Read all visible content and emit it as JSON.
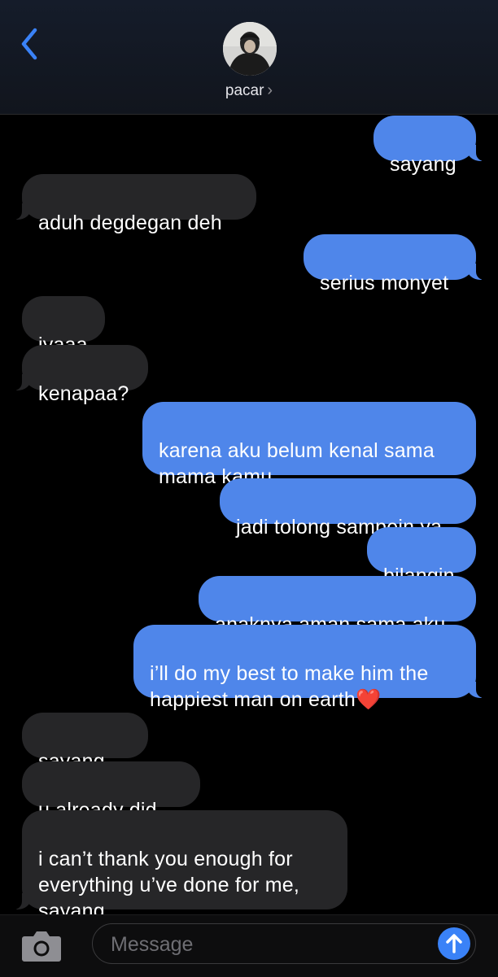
{
  "header": {
    "back_icon": "chevron-left-icon",
    "contact_name": "pacar",
    "contact_chevron": "›",
    "accent": "#3a82f7"
  },
  "messages": [
    {
      "direction": "sent",
      "text": "sayang"
    },
    {
      "direction": "received",
      "text": "aduh degdegan deh"
    },
    {
      "direction": "sent",
      "text": "serius monyet"
    },
    {
      "direction": "received",
      "text": "iyaaa"
    },
    {
      "direction": "received",
      "text": "kenapaa?"
    },
    {
      "direction": "sent",
      "text": "karena aku belum kenal sama\nmama kamu"
    },
    {
      "direction": "sent",
      "text": "jadi tolong sampein ya"
    },
    {
      "direction": "sent",
      "text": "bilangin"
    },
    {
      "direction": "sent",
      "text": "anaknya aman sama aku"
    },
    {
      "direction": "sent",
      "text": "i’ll do my best to make him the\nhappiest man on earth❤️"
    },
    {
      "direction": "received",
      "text": "sayang...."
    },
    {
      "direction": "received",
      "text": "u already did..."
    },
    {
      "direction": "received",
      "text": "i can’t thank you enough for\neverything u’ve done for me,\nsayang.."
    }
  ],
  "composer": {
    "placeholder": "Message",
    "camera_icon": "camera-icon",
    "send_icon": "send-arrow-up-icon"
  },
  "colors": {
    "sent_bubble": "#4f86ea",
    "received_bubble": "#262628",
    "background": "#000000"
  }
}
